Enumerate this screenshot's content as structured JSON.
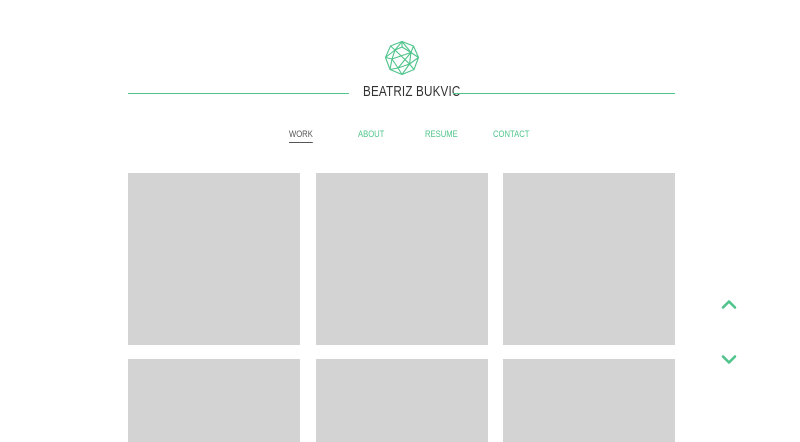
{
  "header": {
    "title": "BEATRIZ BUKVIC",
    "logo_icon": "geodesic-sphere-icon"
  },
  "nav": {
    "items": [
      {
        "label": "WORK",
        "active": true
      },
      {
        "label": "ABOUT",
        "active": false
      },
      {
        "label": "RESUME",
        "active": false
      },
      {
        "label": "CONTACT",
        "active": false
      }
    ]
  },
  "gallery": {
    "tiles": 6,
    "placeholder_color": "#d3d3d3"
  },
  "scroll_controls": {
    "up_icon": "chevron-up-icon",
    "down_icon": "chevron-down-icon"
  },
  "colors": {
    "accent": "#4fc48b",
    "text": "#333333",
    "placeholder": "#d3d3d3"
  }
}
